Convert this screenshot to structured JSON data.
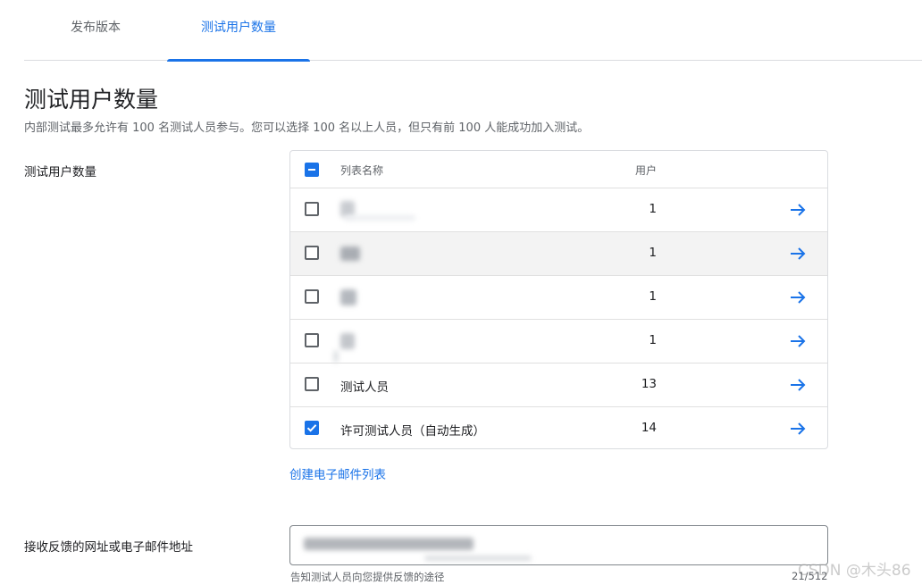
{
  "tabs": [
    {
      "label": "发布版本"
    },
    {
      "label": "测试用户数量"
    }
  ],
  "page": {
    "title": "测试用户数量",
    "description": "内部测试最多允许有 100 名测试人员参与。您可以选择 100 名以上人员，但只有前 100 人能成功加入测试。"
  },
  "testers": {
    "label": "测试用户数量",
    "header": {
      "name": "列表名称",
      "users": "用户"
    },
    "rows": [
      {
        "name": "",
        "users": "1",
        "checked": false
      },
      {
        "name": "",
        "users": "1",
        "checked": false
      },
      {
        "name": "",
        "users": "1",
        "checked": false
      },
      {
        "name": "",
        "users": "1",
        "checked": false
      },
      {
        "name": "测试人员",
        "users": "13",
        "checked": false
      },
      {
        "name": "许可测试人员（自动生成）",
        "users": "14",
        "checked": true
      }
    ],
    "create_link": "创建电子邮件列表"
  },
  "feedback": {
    "label": "接收反馈的网址或电子邮件地址",
    "hint": "告知测试人员向您提供反馈的途径",
    "counter": "21/512"
  },
  "watermark": "CSDN @木头86",
  "colors": {
    "accent": "#1a73e8",
    "border": "#dadce0",
    "row_hover": "#f3f3f3"
  },
  "icons": {
    "row_action": "arrow-right-icon",
    "header_checkbox": "indeterminate-checkbox-icon"
  }
}
